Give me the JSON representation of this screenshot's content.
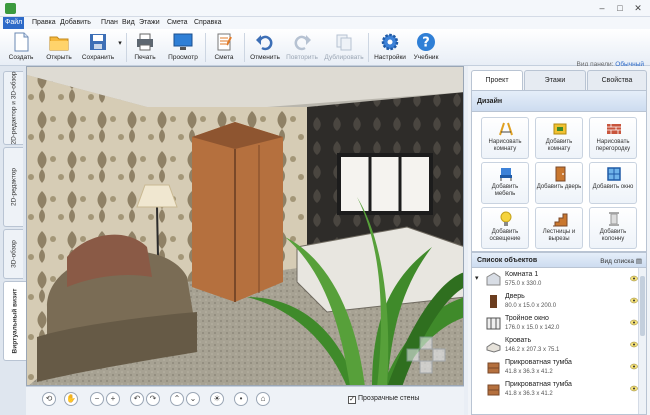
{
  "menu": [
    "Файл",
    "Правка",
    "Добавить",
    "План",
    "Вид",
    "Этажи",
    "Смета",
    "Справка"
  ],
  "toolbar": {
    "create": "Создать",
    "open": "Открыть",
    "save": "Сохранить",
    "print": "Печать",
    "preview": "Просмотр",
    "estimate": "Смета",
    "undo": "Отменить",
    "redo": "Повторить",
    "duplicate": "Дублировать",
    "settings": "Настройки",
    "tutorial": "Учебник"
  },
  "view_mode": {
    "label": "Вид панели:",
    "value": "Обычный"
  },
  "view_tabs": [
    "2D-редактор и 3D-обзор",
    "2D-редактор",
    "3D-обзор",
    "Виртуальный визит"
  ],
  "right_tabs": [
    "Проект",
    "Этажи",
    "Свойства"
  ],
  "design": {
    "title": "Дизайн",
    "tools": [
      "Нарисовать комнату",
      "Добавить комнату",
      "Нарисовать перегородку",
      "Добавить мебель",
      "Добавить дверь",
      "Добавить окно",
      "Добавить освещение",
      "Лестницы и вырезы",
      "Добавить колонну"
    ]
  },
  "objects": {
    "title": "Список объектов",
    "view_list": "Вид списка",
    "items": [
      {
        "name": "Комната 1",
        "dims": "575.0 x 330.0"
      },
      {
        "name": "Дверь",
        "dims": "80.0 x 15.0 x 200.0"
      },
      {
        "name": "Тройное окно",
        "dims": "176.0 x 15.0 x 142.0"
      },
      {
        "name": "Кровать",
        "dims": "146.2 x 207.3 x 75.1"
      },
      {
        "name": "Прикроватная тумба",
        "dims": "41.8 x 36.3 x 41.2"
      },
      {
        "name": "Прикроватная тумба",
        "dims": "41.8 x 36.3 x 41.2"
      }
    ]
  },
  "transparent_walls": "Прозрачные стены",
  "colors": {
    "accent": "#2d6ac8",
    "wall": "#c9b99a",
    "wardrobe": "#b5703e",
    "plant": "#3f8a2a"
  }
}
